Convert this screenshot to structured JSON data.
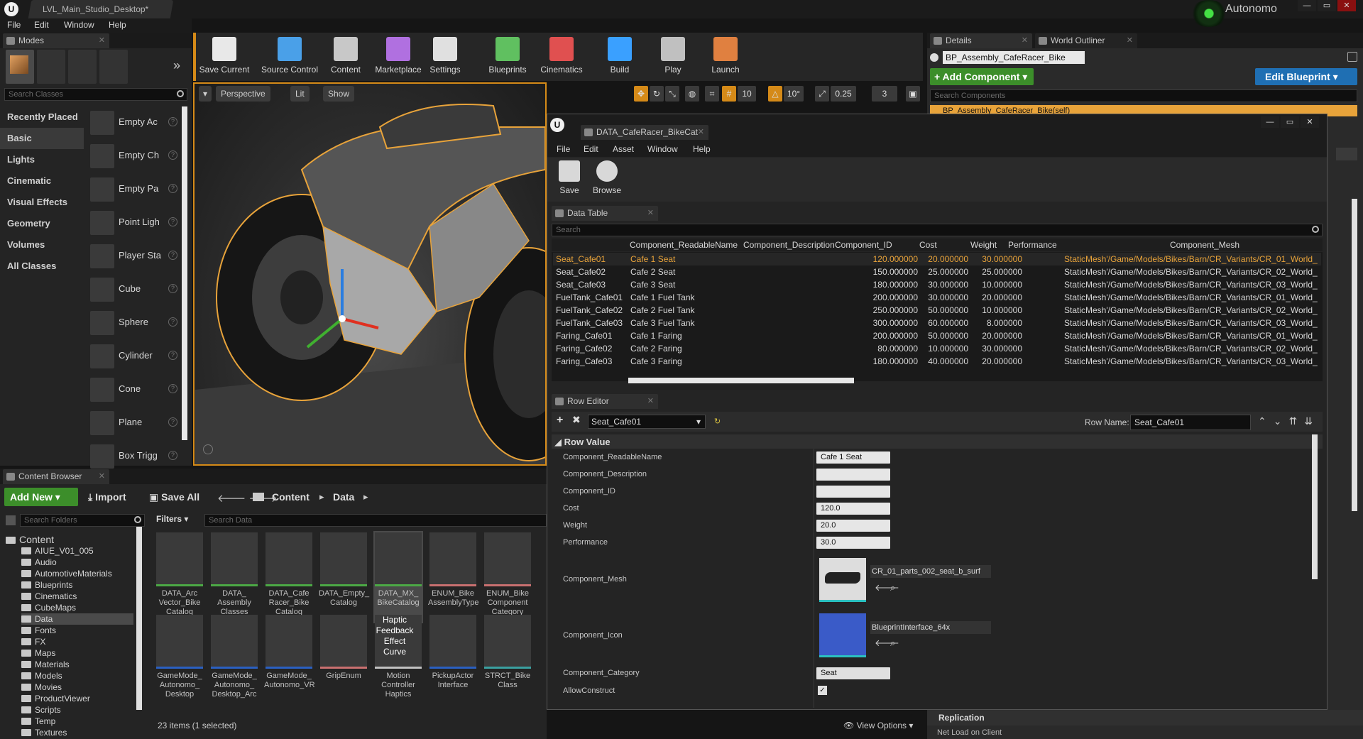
{
  "app": {
    "logo": "U",
    "map_tab": "LVL_Main_Studio_Desktop*",
    "user": "Autonomo",
    "window_controls": [
      "—",
      "▭",
      "✕"
    ]
  },
  "menu": [
    "File",
    "Edit",
    "Window",
    "Help"
  ],
  "modes": {
    "tab": "Modes",
    "search_placeholder": "Search Classes",
    "categories": [
      "Recently Placed",
      "Basic",
      "Lights",
      "Cinematic",
      "Visual Effects",
      "Geometry",
      "Volumes",
      "All Classes"
    ],
    "items": [
      "Empty Ac",
      "Empty Ch",
      "Empty Pa",
      "Point Ligh",
      "Player Sta",
      "Cube",
      "Sphere",
      "Cylinder",
      "Cone",
      "Plane",
      "Box Trigg"
    ]
  },
  "toolbar": [
    "Save Current",
    "Source Control",
    "Content",
    "Marketplace",
    "Settings",
    "Blueprints",
    "Cinematics",
    "Build",
    "Play",
    "Launch"
  ],
  "viewport": {
    "perspective": "Perspective",
    "lit": "Lit",
    "show": "Show",
    "grid": "10",
    "rot": "10°",
    "scale": "0.25",
    "cam": "3"
  },
  "details": {
    "tab1": "Details",
    "tab2": "World Outliner",
    "actor": "BP_Assembly_CafeRacer_Bike",
    "add_component": "+ Add Component ▾",
    "edit_blueprint": "Edit Blueprint ▾",
    "search": "Search Components",
    "self_item": "BP_Assembly_CafeRacer_Bike(self)",
    "replication": "Replication",
    "net_load": "Net Load on Client"
  },
  "asset_editor": {
    "tab": "DATA_CafeRacer_BikeCat",
    "menu": [
      "File",
      "Edit",
      "Asset",
      "Window",
      "Help"
    ],
    "save": "Save",
    "browse": "Browse",
    "data_table_tab": "Data Table",
    "search": "Search",
    "columns": [
      "Component_ReadableName",
      "Component_Description",
      "Component_ID",
      "Cost",
      "Weight",
      "Performance",
      "Component_Mesh"
    ],
    "rows": [
      [
        "Seat_Cafe01",
        "Cafe 1 Seat",
        "120.000000",
        "20.000000",
        "30.000000",
        "StaticMesh'/Game/Models/Bikes/Barn/CR_Variants/CR_01_World_"
      ],
      [
        "Seat_Cafe02",
        "Cafe 2 Seat",
        "150.000000",
        "25.000000",
        "25.000000",
        "StaticMesh'/Game/Models/Bikes/Barn/CR_Variants/CR_02_World_"
      ],
      [
        "Seat_Cafe03",
        "Cafe 3 Seat",
        "180.000000",
        "30.000000",
        "10.000000",
        "StaticMesh'/Game/Models/Bikes/Barn/CR_Variants/CR_03_World_"
      ],
      [
        "FuelTank_Cafe01",
        "Cafe 1 Fuel Tank",
        "200.000000",
        "30.000000",
        "20.000000",
        "StaticMesh'/Game/Models/Bikes/Barn/CR_Variants/CR_01_World_"
      ],
      [
        "FuelTank_Cafe02",
        "Cafe 2 Fuel Tank",
        "250.000000",
        "50.000000",
        "10.000000",
        "StaticMesh'/Game/Models/Bikes/Barn/CR_Variants/CR_02_World_"
      ],
      [
        "FuelTank_Cafe03",
        "Cafe 3 Fuel Tank",
        "300.000000",
        "60.000000",
        "8.000000",
        "StaticMesh'/Game/Models/Bikes/Barn/CR_Variants/CR_03_World_"
      ],
      [
        "Faring_Cafe01",
        "Cafe 1 Faring",
        "200.000000",
        "50.000000",
        "20.000000",
        "StaticMesh'/Game/Models/Bikes/Barn/CR_Variants/CR_01_World_"
      ],
      [
        "Faring_Cafe02",
        "Cafe 2 Faring",
        "80.000000",
        "10.000000",
        "30.000000",
        "StaticMesh'/Game/Models/Bikes/Barn/CR_Variants/CR_02_World_"
      ],
      [
        "Faring_Cafe03",
        "Cafe 3 Faring",
        "180.000000",
        "40.000000",
        "20.000000",
        "StaticMesh'/Game/Models/Bikes/Barn/CR_Variants/CR_03_World_"
      ]
    ],
    "row_editor_tab": "Row Editor",
    "row_select": "Seat_Cafe01",
    "row_name_label": "Row Name:",
    "row_name": "Seat_Cafe01",
    "row_value": "Row Value",
    "props": {
      "readable_label": "Component_ReadableName",
      "readable_val": "Cafe 1 Seat",
      "desc_label": "Component_Description",
      "desc_val": "",
      "id_label": "Component_ID",
      "id_val": "",
      "cost_label": "Cost",
      "cost_val": "120.0",
      "weight_label": "Weight",
      "weight_val": "20.0",
      "perf_label": "Performance",
      "perf_val": "30.0",
      "mesh_label": "Component_Mesh",
      "mesh_val": "CR_01_parts_002_seat_b_surf",
      "icon_label": "Component_Icon",
      "icon_val": "BlueprintInterface_64x",
      "cat_label": "Component_Category",
      "cat_val": "Seat",
      "allow_label": "AllowConstruct"
    }
  },
  "content_browser": {
    "tab": "Content Browser",
    "add_new": "Add New ▾",
    "import": "Import",
    "save_all": "Save All",
    "crumbs": [
      "Content",
      "Data"
    ],
    "search_folders": "Search Folders",
    "filters": "Filters ▾",
    "search_data": "Search Data",
    "status": "23 items (1 selected)",
    "view_options": "View Options ▾",
    "folders": [
      "Content",
      "AIUE_V01_005",
      "Audio",
      "AutomotiveMaterials",
      "Blueprints",
      "Cinematics",
      "CubeMaps",
      "Data",
      "Fonts",
      "FX",
      "Maps",
      "Materials",
      "Models",
      "Movies",
      "ProductViewer",
      "Scripts",
      "Temp",
      "Textures"
    ],
    "assets": [
      "DATA_Arc Vector_Bike Catalog",
      "DATA_ Assembly Classes",
      "DATA_Cafe Racer_Bike Catalog",
      "DATA_Empty_ Catalog",
      "DATA_MX_ BikeCatalog",
      "ENUM_Bike AssemblyType",
      "ENUM_Bike Component Category",
      "GameMode_ Autonomo_ Desktop",
      "GameMode_ Autonomo_ Desktop_Arc",
      "GameMode_ Autonomo_VR",
      "GripEnum",
      "Motion Controller Haptics",
      "PickupActor Interface",
      "STRCT_Bike Class"
    ],
    "haptic_thumb": "Haptic Feedback Effect Curve"
  },
  "colors": {
    "accent": "#e8a33a",
    "selected": "#4a4a4a",
    "green": "#3c8e2a",
    "blue": "#1f6fb3"
  }
}
